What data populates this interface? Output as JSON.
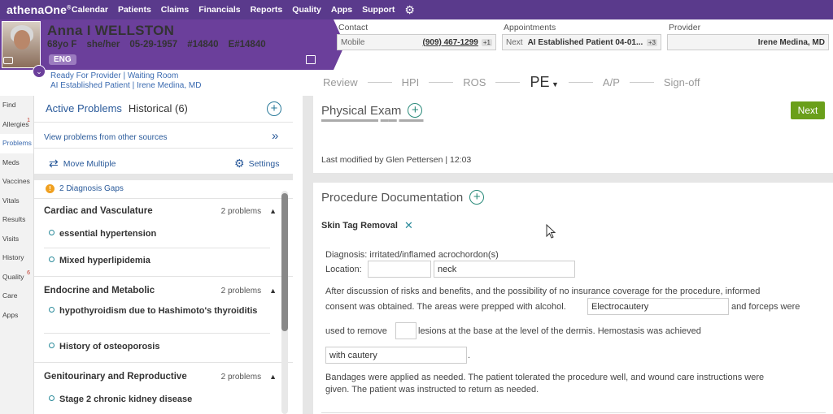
{
  "topnav": {
    "logo": "athenaOne",
    "items": [
      "Calendar",
      "Patients",
      "Claims",
      "Financials",
      "Reports",
      "Quality",
      "Apps",
      "Support"
    ]
  },
  "patient": {
    "name": "Anna I WELLSTON",
    "age_sex": "68yo F",
    "pronouns": "she/her",
    "dob": "05-29-1957",
    "id1": "#14840",
    "id2": "E#14840",
    "lang": "ENG",
    "status_line": "Ready For Provider | Waiting Room",
    "visit_line": "AI Established Patient | Irene Medina, MD"
  },
  "contact": {
    "label": "Contact",
    "type": "Mobile",
    "phone": "(909) 467-1299",
    "more": "+1"
  },
  "appointments": {
    "label": "Appointments",
    "prefix": "Next",
    "value": "AI Established Patient 04-01...",
    "more": "+3"
  },
  "provider": {
    "label": "Provider",
    "value": "Irene Medina, MD"
  },
  "tabs": [
    "Review",
    "HPI",
    "ROS",
    "PE",
    "A/P",
    "Sign-off"
  ],
  "leftnav": [
    {
      "label": "Find",
      "count": ""
    },
    {
      "label": "Allergies",
      "count": "1"
    },
    {
      "label": "Problems",
      "count": ""
    },
    {
      "label": "Meds",
      "count": ""
    },
    {
      "label": "Vaccines",
      "count": ""
    },
    {
      "label": "Vitals",
      "count": ""
    },
    {
      "label": "Results",
      "count": ""
    },
    {
      "label": "Visits",
      "count": ""
    },
    {
      "label": "History",
      "count": ""
    },
    {
      "label": "Quality",
      "count": "6"
    },
    {
      "label": "Care",
      "count": ""
    },
    {
      "label": "Apps",
      "count": ""
    }
  ],
  "problems": {
    "tab_active": "Active Problems",
    "tab_historical": "Historical (6)",
    "view_other": "View problems from other sources",
    "move_multiple": "Move Multiple",
    "settings": "Settings",
    "diag_gaps": "2 Diagnosis Gaps",
    "categories": [
      {
        "name": "Cardiac and Vasculature",
        "count": "2 problems",
        "items": [
          "essential hypertension",
          "Mixed hyperlipidemia"
        ]
      },
      {
        "name": "Endocrine and Metabolic",
        "count": "2 problems",
        "items": [
          "hypothyroidism due to Hashimoto's thyroiditis",
          "History of osteoporosis"
        ]
      },
      {
        "name": "Genitourinary and Reproductive",
        "count": "2 problems",
        "items": [
          "Stage 2 chronic kidney disease"
        ]
      }
    ]
  },
  "physical_exam": {
    "title": "Physical Exam",
    "next": "Next",
    "last_modified": "Last modified by Glen Pettersen | 12:03"
  },
  "procedure": {
    "title": "Procedure Documentation",
    "name": "Skin Tag Removal",
    "diagnosis": "Diagnosis: irritated/inflamed acrochordon(s)",
    "location_label": "Location:",
    "location_value1": "",
    "location_value2": "neck",
    "para1a": "After discussion of risks and benefits, and the possibility of no insurance coverage for the procedure, informed",
    "para1b": "consent was obtained. The areas were prepped with alcohol.",
    "method_value": "Electrocautery",
    "para1c": "and forceps were",
    "para2a": "used to remove",
    "lesions_value": "",
    "para2b": "lesions at the base at the level of the dermis. Hemostasis was achieved",
    "hemostasis_value": "with cautery",
    "period": ".",
    "para3a": "Bandages were applied as needed. The patient tolerated the procedure well, and wound care instructions were",
    "para3b": "given. The patient was instructed to return as needed."
  },
  "colors": {
    "header_purple": "#6b3f9b",
    "nav_purple": "#5a3a8c",
    "next_green": "#6a9f1a",
    "link_blue": "#2a5a9a"
  }
}
